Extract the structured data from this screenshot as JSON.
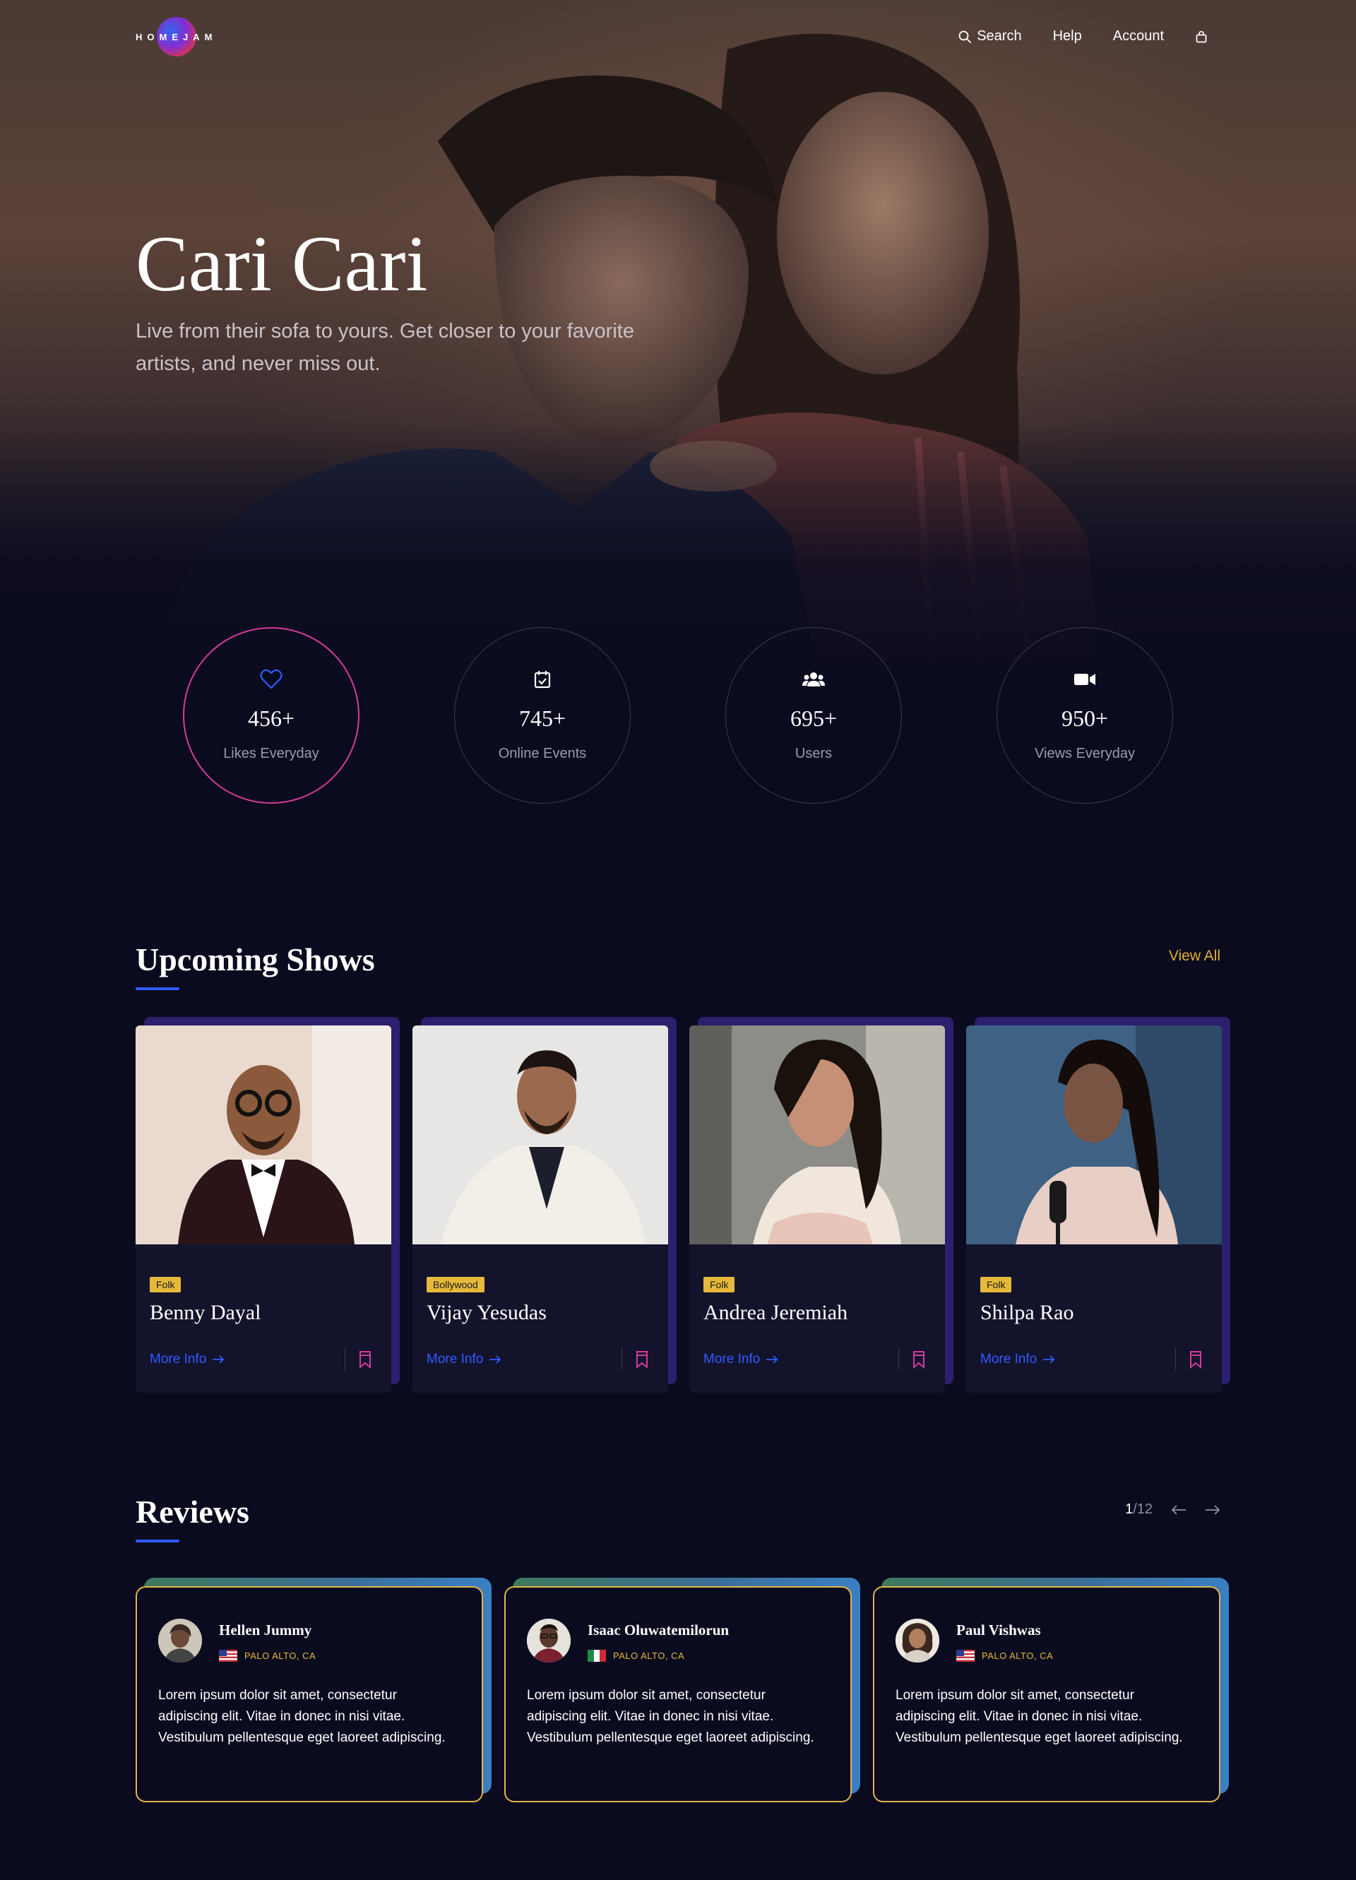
{
  "nav": {
    "logo": "HOMEJAM",
    "search": "Search",
    "help": "Help",
    "account": "Account",
    "icons": [
      "search-icon",
      "bag-icon"
    ]
  },
  "hero": {
    "title": "Cari Cari",
    "subtitle": "Live from their sofa to yours. Get closer to your favorite artists, and never miss out."
  },
  "stats": [
    {
      "icon": "heart-icon",
      "value": "456+",
      "label": "Likes Everyday"
    },
    {
      "icon": "calendar-icon",
      "value": "745+",
      "label": "Online Events"
    },
    {
      "icon": "users-icon",
      "value": "695+",
      "label": "Users"
    },
    {
      "icon": "video-camera-icon",
      "value": "950+",
      "label": "Views Everyday"
    }
  ],
  "upcoming": {
    "title": "Upcoming Shows",
    "view_all": "View All",
    "cards": [
      {
        "genre": "Folk",
        "name": "Benny Dayal",
        "more": "More Info"
      },
      {
        "genre": "Bollywood",
        "name": "Vijay Yesudas",
        "more": "More Info"
      },
      {
        "genre": "Folk",
        "name": "Andrea Jeremiah",
        "more": "More Info"
      },
      {
        "genre": "Folk",
        "name": "Shilpa Rao",
        "more": "More Info"
      }
    ]
  },
  "reviews": {
    "title": "Reviews",
    "pager": {
      "current": "1",
      "total": "/12"
    },
    "items": [
      {
        "name": "Hellen Jummy",
        "location": "PALO ALTO, CA",
        "flag": "us-flag",
        "text": "Lorem ipsum dolor sit amet, consectetur adipiscing elit. Vitae in donec in nisi vitae. Vestibulum pellentesque eget laoreet adipiscing."
      },
      {
        "name": "Isaac Oluwatemilorun",
        "location": "PALO ALTO, CA",
        "flag": "italy-flag",
        "text": "Lorem ipsum dolor sit amet, consectetur adipiscing elit. Vitae in donec in nisi vitae. Vestibulum pellentesque eget laoreet adipiscing."
      },
      {
        "name": "Paul Vishwas",
        "location": "PALO ALTO, CA",
        "flag": "us-flag",
        "text": "Lorem ipsum dolor sit amet, consectetur adipiscing elit. Vitae in donec in nisi vitae. Vestibulum pellentesque eget laoreet adipiscing."
      }
    ]
  },
  "colors": {
    "background": "#0b0b1f",
    "accent_blue": "#2f5bff",
    "accent_gold": "#e6b93a",
    "accent_pink": "#d23b9a",
    "card_back": "#2b1f6e"
  }
}
